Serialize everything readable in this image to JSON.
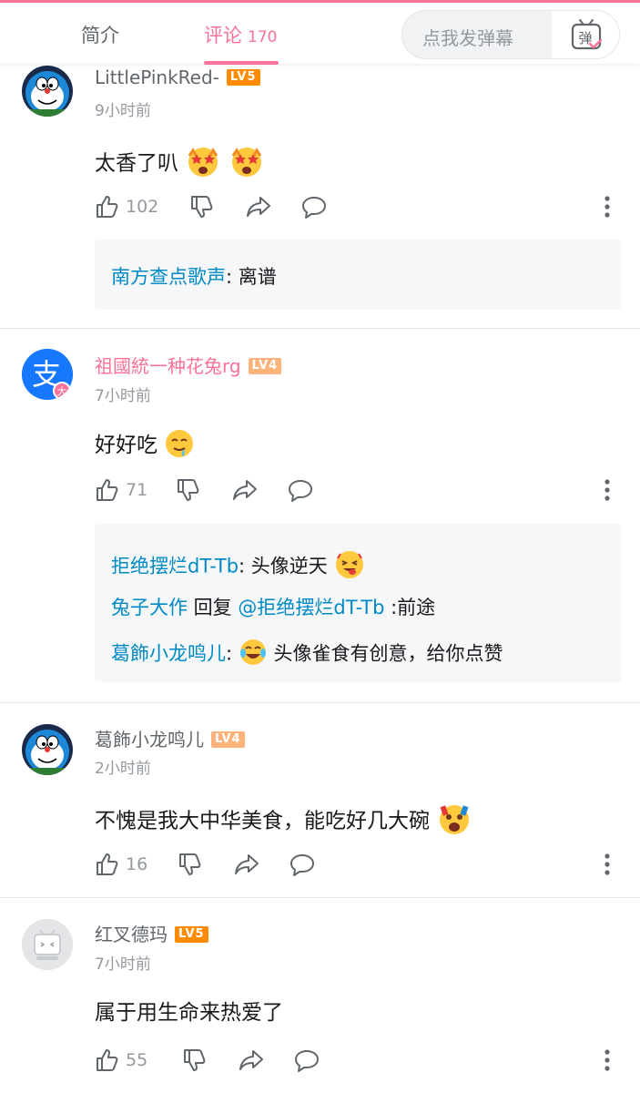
{
  "header": {
    "tab_intro": "简介",
    "tab_comments": "评论",
    "comment_count": "170",
    "danmaku_placeholder": "点我发弹幕",
    "danmaku_button": "弹"
  },
  "comments": [
    {
      "username": "LittlePinkRed-",
      "level": "LV5",
      "time": "9小时前",
      "text": "太香了叭",
      "likes": "102",
      "replies": [
        {
          "name": "南方查点歌声",
          "text": ": 离谱"
        }
      ]
    },
    {
      "username": "祖國統一种花兔rg",
      "level": "LV4",
      "time": "7小时前",
      "text": "好好吃",
      "likes": "71",
      "avatar_text": "支",
      "avatar_badge": "大",
      "replies": [
        {
          "name": "拒绝摆烂dT-Tb",
          "text": ": 头像逆天"
        },
        {
          "name": "兔子大作",
          "middle": " 回复 ",
          "mention": "@拒绝摆烂dT-Tb",
          "text": " :前途"
        },
        {
          "name": "葛飾小龙鸣儿",
          "text": ":",
          "text2": " 头像雀食有创意，给你点赞"
        }
      ]
    },
    {
      "username": "葛飾小龙鸣儿",
      "level": "LV4",
      "time": "2小时前",
      "text": "不愧是我大中华美食，能吃好几大碗",
      "likes": "16"
    },
    {
      "username": "红叉德玛",
      "level": "LV5",
      "time": "7小时前",
      "text": "属于用生命来热爱了",
      "likes": "55"
    }
  ],
  "colors": {
    "accent": "#fb7299",
    "reply_name": "#008ac5",
    "lv5": "#ff8c00",
    "lv4": "#ffb37c",
    "meta_gray": "#9499a0"
  }
}
